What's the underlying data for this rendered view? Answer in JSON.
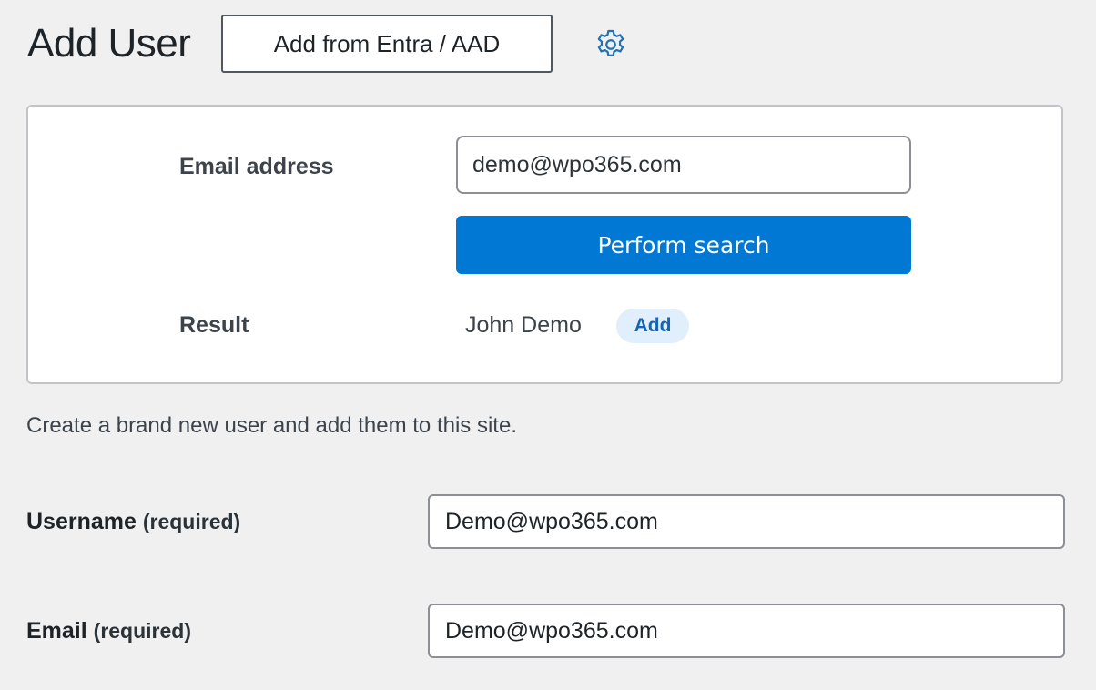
{
  "header": {
    "title": "Add User",
    "entra_button_label": "Add from Entra / AAD",
    "settings_icon": "gear-icon"
  },
  "search_panel": {
    "email_label": "Email address",
    "email_value": "demo@wpo365.com",
    "search_button_label": "Perform search",
    "result_label": "Result",
    "result_name": "John Demo",
    "add_label": "Add"
  },
  "create_form": {
    "description": "Create a brand new user and add them to this site.",
    "username_label": "Username",
    "username_required": "(required)",
    "username_value": "Demo@wpo365.com",
    "email_label": "Email",
    "email_required": "(required)",
    "email_value": "Demo@wpo365.com"
  },
  "colors": {
    "primary_button": "#0078d4",
    "add_pill_bg": "#e0effb",
    "add_pill_text": "#1664b8",
    "page_bg": "#f0f0f1",
    "gear_icon": "#2271b1"
  }
}
